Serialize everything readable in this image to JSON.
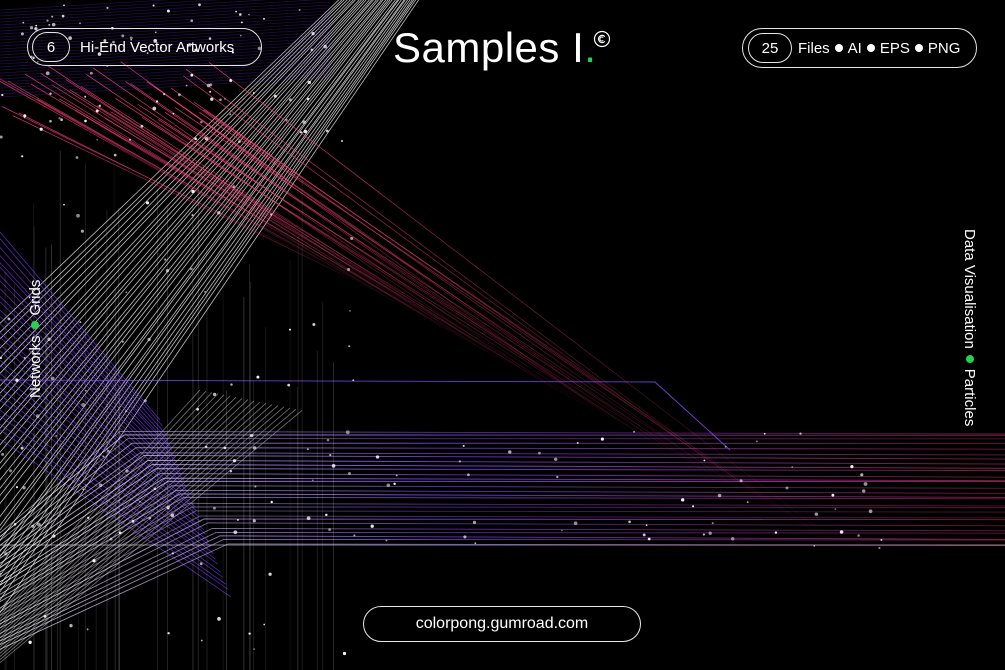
{
  "header": {
    "left_badge": {
      "count": "6",
      "label": "Hi-End Vector Artworks"
    },
    "title": "Samples I",
    "title_period": ".",
    "copyright_icon": "copyright-c-icon",
    "right_badge": {
      "count": "25",
      "formats": [
        "Files",
        "AI",
        "EPS",
        "PNG"
      ]
    }
  },
  "side_labels": {
    "left": [
      "Networks",
      "Grids"
    ],
    "right": [
      "Data Visualisation",
      "Particles"
    ]
  },
  "footer": {
    "url": "colorpong.gumroad.com"
  },
  "colors": {
    "background": "#000000",
    "accent_green": "#21d44a",
    "line_white": "#ffffff",
    "line_purple": "#7a3cff",
    "line_magenta": "#d0306a"
  }
}
